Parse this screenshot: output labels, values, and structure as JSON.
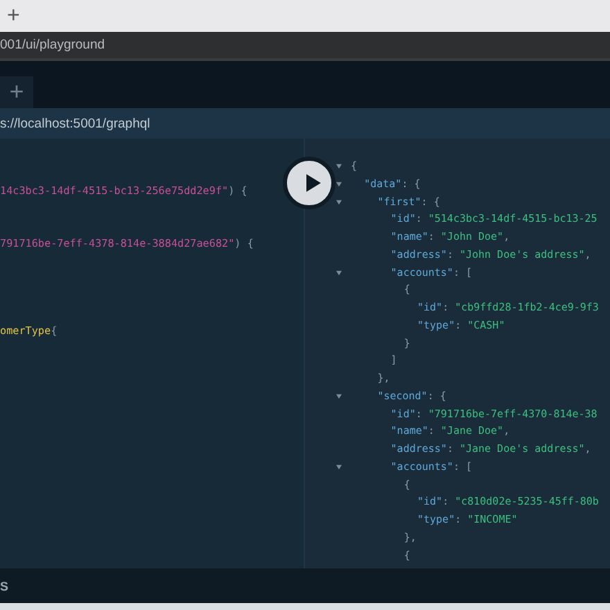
{
  "browser": {
    "new_tab": "+",
    "address": "001/ui/playground"
  },
  "playground": {
    "new_tab": "+",
    "endpoint": "s://localhost:5001/graphql"
  },
  "query_lines": [
    {
      "tokens": [
        {
          "kind": "arg",
          "text": "14c3bc3-14df-4515-bc13-256e75dd2e9f\""
        },
        {
          "kind": "punct",
          "text": ") {"
        }
      ]
    },
    {
      "tokens": [
        {
          "kind": "arg",
          "text": "791716be-7eff-4378-814e-3884d27ae682\""
        },
        {
          "kind": "punct",
          "text": ") {"
        }
      ]
    },
    {
      "tokens": [
        {
          "kind": "type",
          "text": "omerType"
        },
        {
          "kind": "punct",
          "text": "{"
        }
      ]
    }
  ],
  "result": [
    {
      "kind": "fold",
      "tokens": [
        {
          "kind": "punct",
          "text": "{"
        }
      ],
      "children": [
        {
          "kind": "fold",
          "tokens": [
            {
              "kind": "key",
              "text": "\"data\""
            },
            {
              "kind": "punct",
              "text": ": {"
            }
          ],
          "children": [
            {
              "kind": "fold",
              "tokens": [
                {
                  "kind": "key",
                  "text": "\"first\""
                },
                {
                  "kind": "punct",
                  "text": ": {"
                }
              ],
              "children": [
                {
                  "kind": "line",
                  "tokens": [
                    {
                      "kind": "key",
                      "text": "\"id\""
                    },
                    {
                      "kind": "punct",
                      "text": ": "
                    },
                    {
                      "kind": "string",
                      "text": "\"514c3bc3-14df-4515-bc13-25"
                    }
                  ]
                },
                {
                  "kind": "line",
                  "tokens": [
                    {
                      "kind": "key",
                      "text": "\"name\""
                    },
                    {
                      "kind": "punct",
                      "text": ": "
                    },
                    {
                      "kind": "string",
                      "text": "\"John Doe\""
                    },
                    {
                      "kind": "punct",
                      "text": ","
                    }
                  ]
                },
                {
                  "kind": "line",
                  "tokens": [
                    {
                      "kind": "key",
                      "text": "\"address\""
                    },
                    {
                      "kind": "punct",
                      "text": ": "
                    },
                    {
                      "kind": "string",
                      "text": "\"John Doe's address\""
                    },
                    {
                      "kind": "punct",
                      "text": ","
                    }
                  ]
                },
                {
                  "kind": "fold",
                  "tokens": [
                    {
                      "kind": "key",
                      "text": "\"accounts\""
                    },
                    {
                      "kind": "punct",
                      "text": ": ["
                    }
                  ],
                  "children": [
                    {
                      "kind": "line",
                      "tokens": [
                        {
                          "kind": "punct",
                          "text": "{"
                        }
                      ],
                      "children": [
                        {
                          "kind": "line",
                          "tokens": [
                            {
                              "kind": "key",
                              "text": "\"id\""
                            },
                            {
                              "kind": "punct",
                              "text": ": "
                            },
                            {
                              "kind": "string",
                              "text": "\"cb9ffd28-1fb2-4ce9-9f3"
                            }
                          ]
                        },
                        {
                          "kind": "line",
                          "tokens": [
                            {
                              "kind": "key",
                              "text": "\"type\""
                            },
                            {
                              "kind": "punct",
                              "text": ": "
                            },
                            {
                              "kind": "string",
                              "text": "\"CASH\""
                            }
                          ]
                        }
                      ]
                    },
                    {
                      "kind": "line",
                      "tokens": [
                        {
                          "kind": "punct",
                          "text": "}"
                        }
                      ]
                    }
                  ]
                },
                {
                  "kind": "line",
                  "tokens": [
                    {
                      "kind": "punct",
                      "text": "]"
                    }
                  ]
                }
              ]
            },
            {
              "kind": "line",
              "tokens": [
                {
                  "kind": "punct",
                  "text": "},"
                }
              ]
            },
            {
              "kind": "fold",
              "tokens": [
                {
                  "kind": "key",
                  "text": "\"second\""
                },
                {
                  "kind": "punct",
                  "text": ": {"
                }
              ],
              "children": [
                {
                  "kind": "line",
                  "tokens": [
                    {
                      "kind": "key",
                      "text": "\"id\""
                    },
                    {
                      "kind": "punct",
                      "text": ": "
                    },
                    {
                      "kind": "string",
                      "text": "\"791716be-7eff-4370-814e-38"
                    }
                  ]
                },
                {
                  "kind": "line",
                  "tokens": [
                    {
                      "kind": "key",
                      "text": "\"name\""
                    },
                    {
                      "kind": "punct",
                      "text": ": "
                    },
                    {
                      "kind": "string",
                      "text": "\"Jane Doe\""
                    },
                    {
                      "kind": "punct",
                      "text": ","
                    }
                  ]
                },
                {
                  "kind": "line",
                  "tokens": [
                    {
                      "kind": "key",
                      "text": "\"address\""
                    },
                    {
                      "kind": "punct",
                      "text": ": "
                    },
                    {
                      "kind": "string",
                      "text": "\"Jane Doe's address\""
                    },
                    {
                      "kind": "punct",
                      "text": ","
                    }
                  ]
                },
                {
                  "kind": "fold",
                  "tokens": [
                    {
                      "kind": "key",
                      "text": "\"accounts\""
                    },
                    {
                      "kind": "punct",
                      "text": ": ["
                    }
                  ],
                  "children": [
                    {
                      "kind": "line",
                      "tokens": [
                        {
                          "kind": "punct",
                          "text": "{"
                        }
                      ],
                      "children": [
                        {
                          "kind": "line",
                          "tokens": [
                            {
                              "kind": "key",
                              "text": "\"id\""
                            },
                            {
                              "kind": "punct",
                              "text": ": "
                            },
                            {
                              "kind": "string",
                              "text": "\"c810d02e-5235-45ff-80b"
                            }
                          ]
                        },
                        {
                          "kind": "line",
                          "tokens": [
                            {
                              "kind": "key",
                              "text": "\"type\""
                            },
                            {
                              "kind": "punct",
                              "text": ": "
                            },
                            {
                              "kind": "string",
                              "text": "\"INCOME\""
                            }
                          ]
                        }
                      ]
                    },
                    {
                      "kind": "line",
                      "tokens": [
                        {
                          "kind": "punct",
                          "text": "},"
                        }
                      ]
                    },
                    {
                      "kind": "line",
                      "tokens": [
                        {
                          "kind": "punct",
                          "text": "{"
                        }
                      ]
                    }
                  ]
                }
              ]
            }
          ]
        }
      ]
    }
  ],
  "bottom_bar": {
    "label": "S"
  }
}
